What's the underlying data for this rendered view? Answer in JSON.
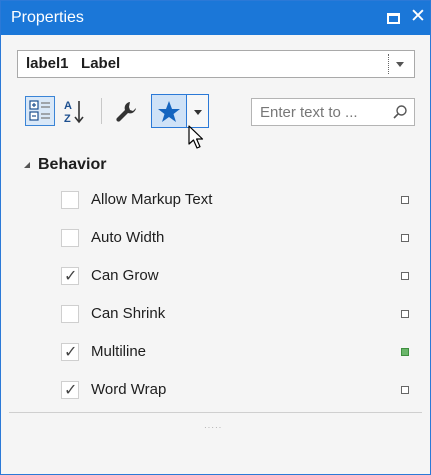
{
  "panel": {
    "title": "Properties",
    "icons": {
      "restore": "restore-icon",
      "close": "close-icon"
    },
    "close_glyph": "✕"
  },
  "selector": {
    "value": "label1   Label"
  },
  "toolbar": {
    "categorized_icon": "categorized-icon",
    "alphabetical_icon": "sort-alphabetical-icon",
    "events_icon": "wrench-icon",
    "favorites_icon": "star-icon",
    "dropdown_icon": "chevron-down-icon",
    "search_placeholder": "Enter text to ...",
    "search_icon": "search-icon"
  },
  "grid": {
    "category": "Behavior",
    "properties": [
      {
        "name": "Allow Markup Text",
        "checked": false,
        "modified": false
      },
      {
        "name": "Auto Width",
        "checked": false,
        "modified": false
      },
      {
        "name": "Can Grow",
        "checked": true,
        "modified": false
      },
      {
        "name": "Can Shrink",
        "checked": false,
        "modified": false
      },
      {
        "name": "Multiline",
        "checked": true,
        "modified": true
      },
      {
        "name": "Word Wrap",
        "checked": true,
        "modified": false
      }
    ]
  },
  "colors": {
    "title_bar": "#1b77d8",
    "accent": "#2b79d7",
    "modified_marker": "#6ab56a"
  }
}
